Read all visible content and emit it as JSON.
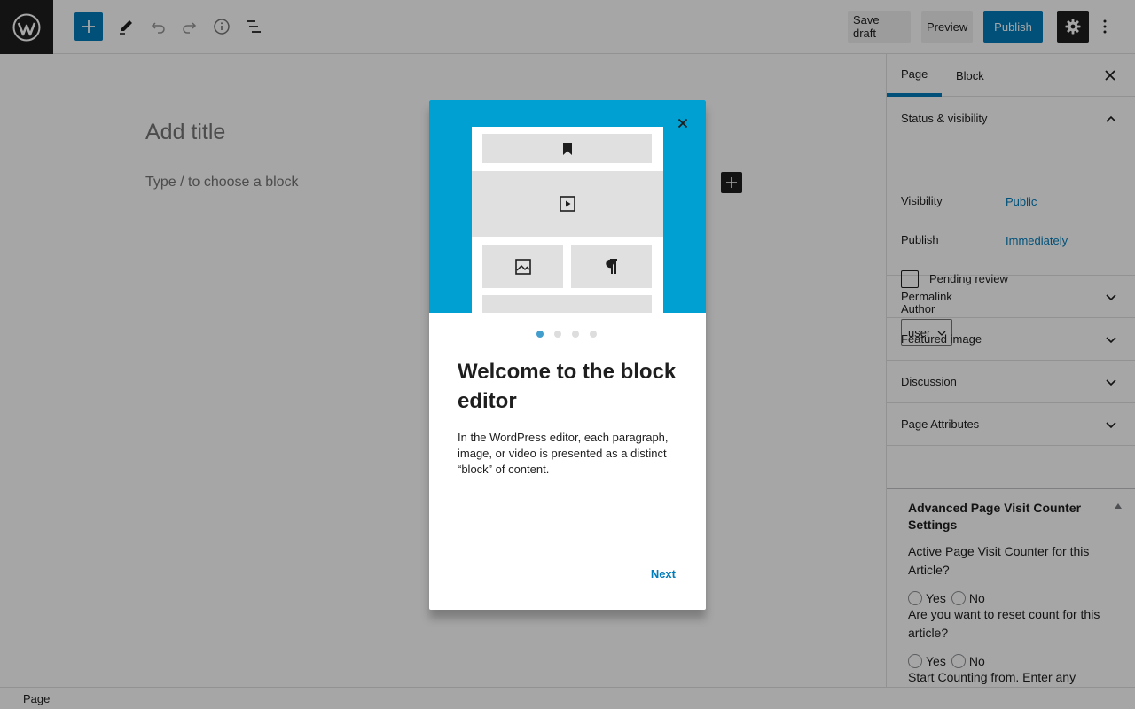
{
  "toolbar": {
    "save_draft": "Save draft",
    "preview": "Preview",
    "publish": "Publish"
  },
  "editor": {
    "title_placeholder": "Add title",
    "block_placeholder": "Type / to choose a block"
  },
  "sidebar": {
    "tabs": [
      {
        "label": "Page"
      },
      {
        "label": "Block"
      }
    ],
    "status": {
      "title": "Status & visibility",
      "visibility_label": "Visibility",
      "visibility_value": "Public",
      "publish_label": "Publish",
      "publish_value": "Immediately",
      "pending_label": "Pending review",
      "author_label": "Author",
      "author_value": "user"
    },
    "panels": [
      {
        "title": "Permalink"
      },
      {
        "title": "Featured image"
      },
      {
        "title": "Discussion"
      },
      {
        "title": "Page Attributes"
      }
    ],
    "advanced": {
      "title": "Advanced Page Visit Counter Settings",
      "question1": "Active Page Visit Counter for this Article?",
      "question2": "Are you want to reset count for this article?",
      "question3": "Start Counting from. Enter any",
      "yes": "Yes",
      "no": "No"
    }
  },
  "footer": {
    "breadcrumb": "Page"
  },
  "guide": {
    "title": "Welcome to the block editor",
    "body": "In the WordPress editor, each paragraph, image, or video is presented as a distinct “block” of content.",
    "next": "Next",
    "current_page": 1,
    "total_pages": 4
  },
  "colors": {
    "accent": "#007cba",
    "hero": "#00a0d2",
    "dark": "#1e1e1e"
  }
}
